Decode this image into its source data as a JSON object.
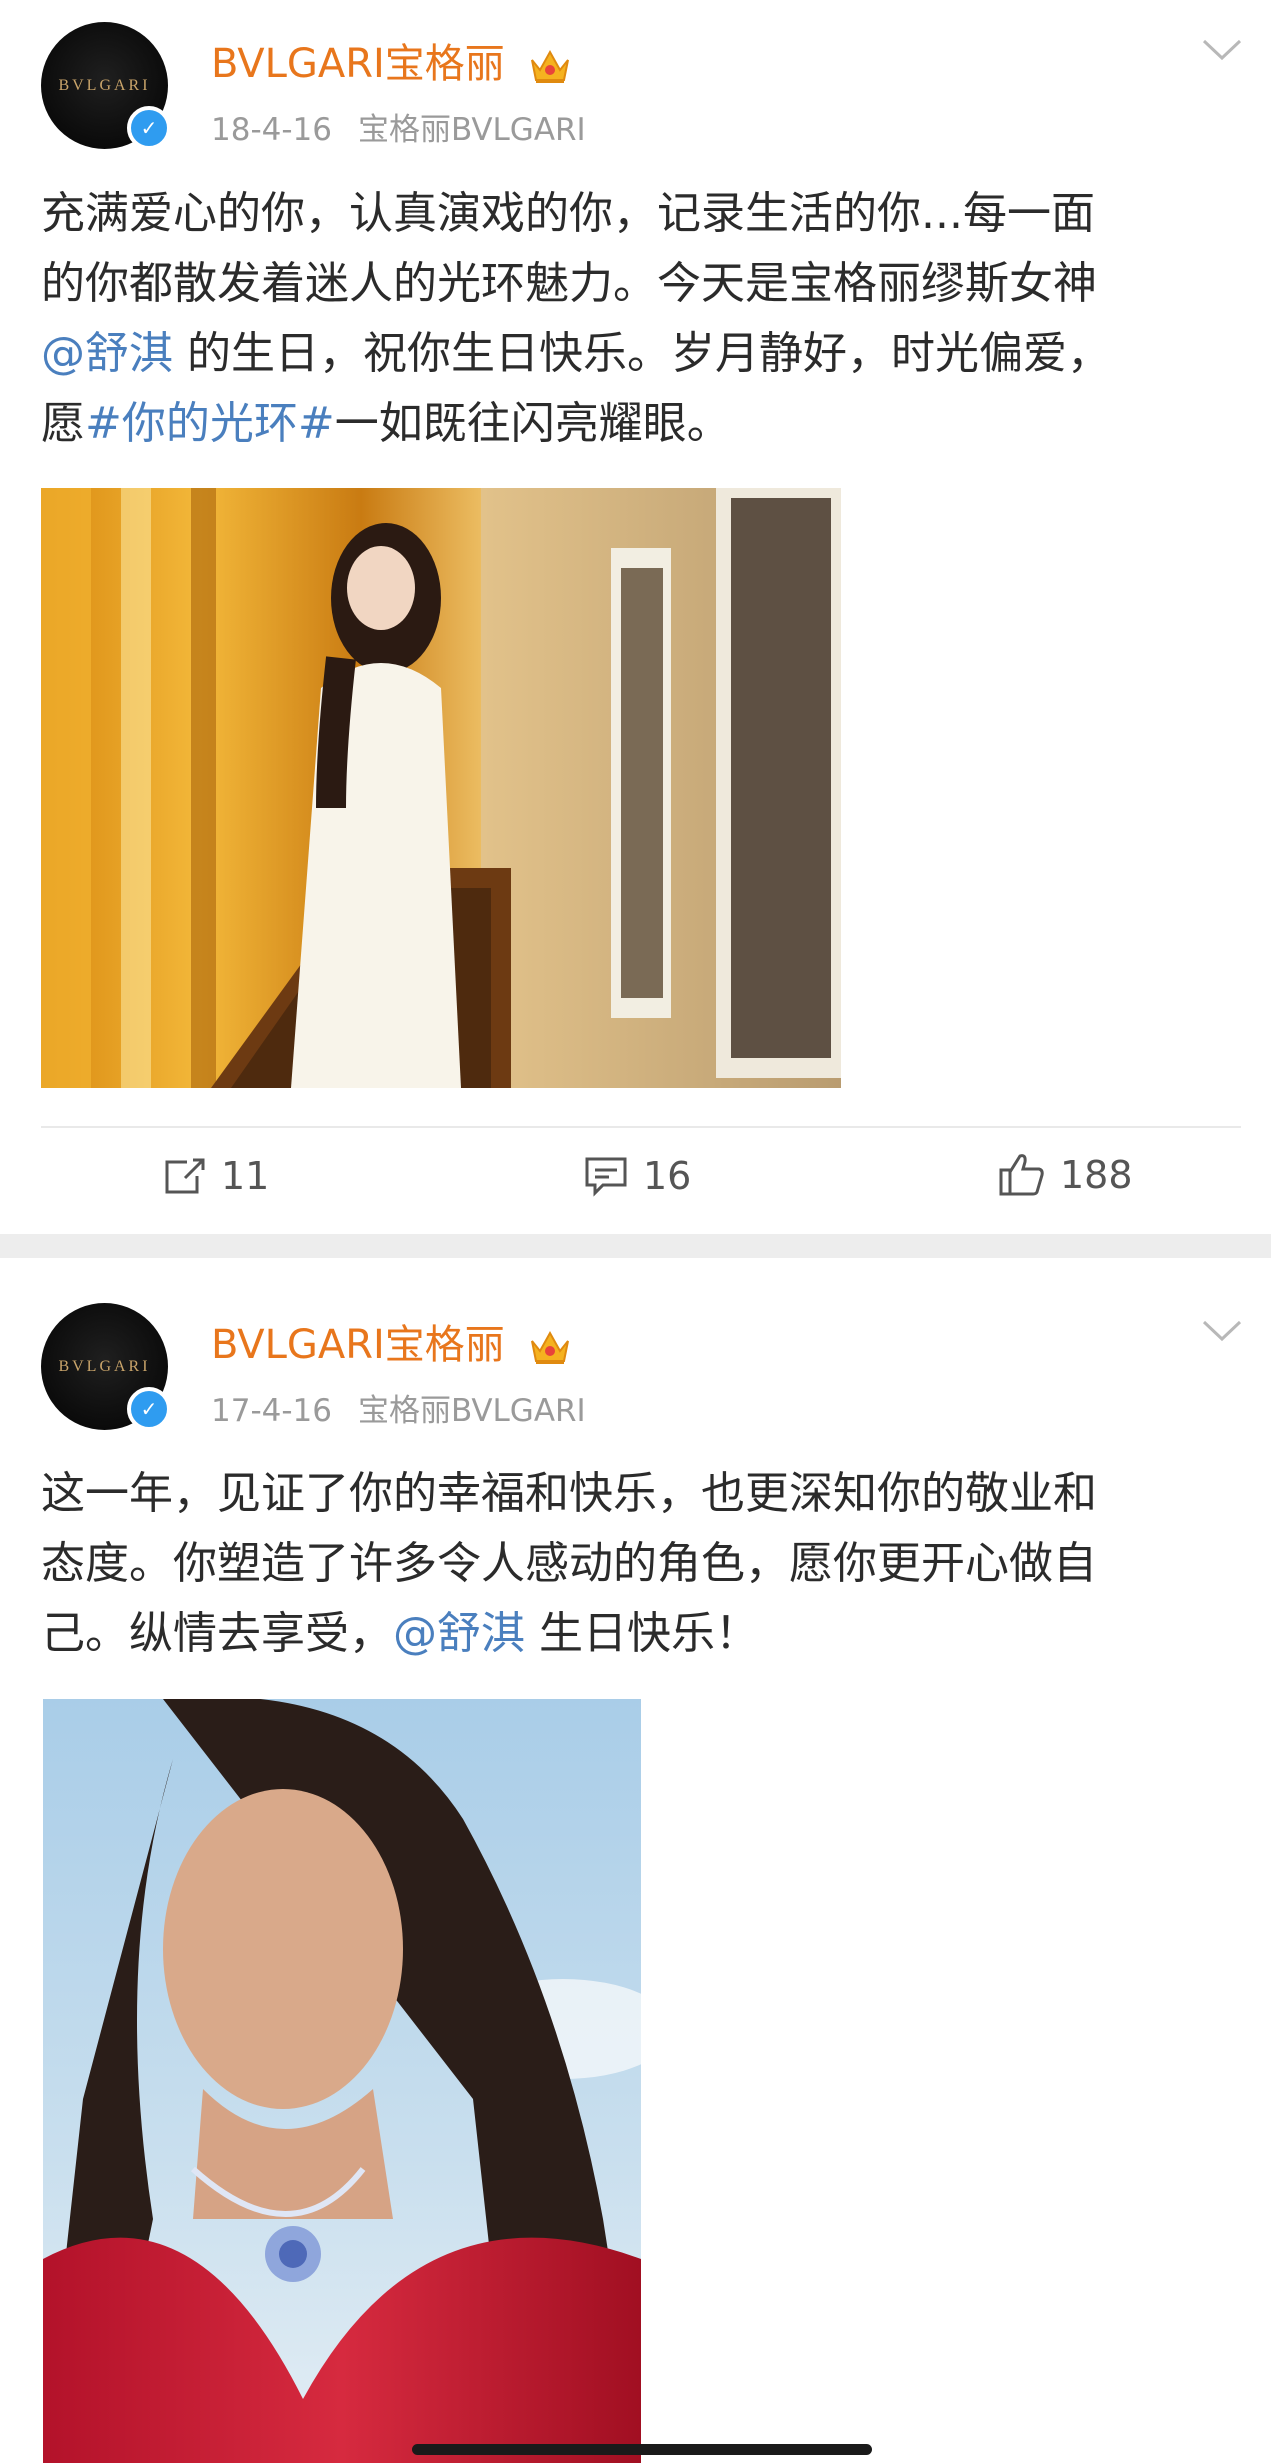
{
  "posts": [
    {
      "author": "BVLGARI宝格丽",
      "avatar_text": "BVLGARI",
      "date": "18-4-16",
      "source": "宝格丽BVLGARI",
      "text": {
        "line1": "充满爱心的你，认真演戏的你，记录生活的你...每一面",
        "line2": "的你都散发着迷人的光环魅力。今天是宝格丽缪斯女神",
        "line3_mention": "@舒淇",
        "line3_rest": " 的生日，祝你生日快乐。岁月静好，时光偏爱，",
        "line4_pre": "愿",
        "line4_hashtag": "#你的光环#",
        "line4_rest": "一如既往闪亮耀眼。"
      },
      "photo_alt": "woman in white suit in golden corridor",
      "actions": {
        "repost": "11",
        "comment": "16",
        "like": "188"
      }
    },
    {
      "author": "BVLGARI宝格丽",
      "avatar_text": "BVLGARI",
      "date": "17-4-16",
      "source": "宝格丽BVLGARI",
      "text": {
        "line1": "这一年，见证了你的幸福和快乐，也更深知你的敬业和",
        "line2": "态度。你塑造了许多令人感动的角色，愿你更开心做自",
        "line3_pre": "己。纵情去享受，",
        "line3_mention": "@舒淇",
        "line3_rest": " 生日快乐！"
      },
      "photo_alt": "woman in red top wearing diamond necklace"
    }
  ],
  "colors": {
    "author": "#e8761c",
    "link": "#4a7fbe",
    "meta": "#9a9a9a",
    "separator": "#ededed",
    "verified": "#2f9cf0"
  },
  "icons": [
    "crown-icon",
    "verified-icon",
    "chevron-down-icon",
    "repost-icon",
    "comment-icon",
    "like-icon"
  ]
}
